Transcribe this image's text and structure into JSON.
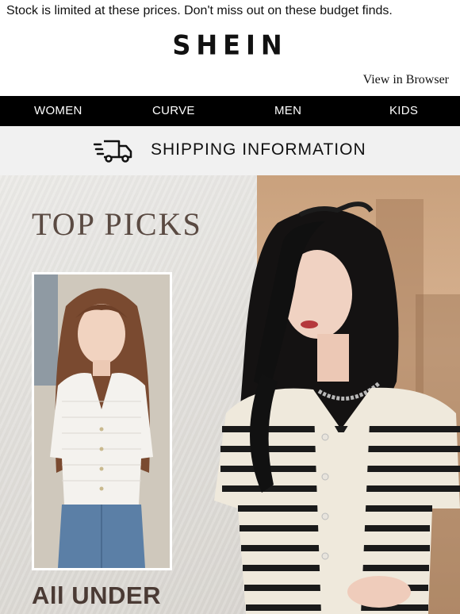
{
  "preheader": "Stock is limited at these prices. Don't miss out on these budget finds.",
  "brand": {
    "logo": "SHEIN"
  },
  "view_in_browser": "View in Browser",
  "nav": {
    "items": [
      {
        "label": "WOMEN"
      },
      {
        "label": "CURVE"
      },
      {
        "label": "MEN"
      },
      {
        "label": "KIDS"
      }
    ]
  },
  "shipping": {
    "label": "SHIPPING INFORMATION",
    "icon": "truck-icon"
  },
  "hero": {
    "headline": "TOP PICKS",
    "subheadline": "All UNDER"
  },
  "colors": {
    "nav_background": "#000000",
    "shipping_background": "#f1f1f1",
    "headline_color": "#5a4a42"
  }
}
